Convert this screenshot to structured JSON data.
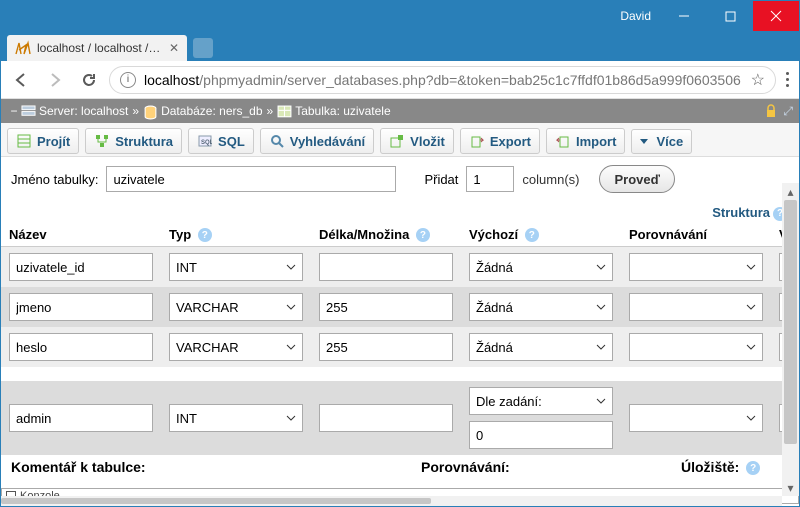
{
  "window": {
    "user": "David"
  },
  "tab": {
    "title": "localhost / localhost / ne"
  },
  "url": {
    "host": "localhost",
    "path": "/phpmyadmin/server_databases.php?db=&token=bab25c1c7ffdf01b86d5a999f0603506"
  },
  "breadcrumb": {
    "server_label": "Server:",
    "server": "localhost",
    "db_label": "Databáze:",
    "db": "ners_db",
    "table_label": "Tabulka:",
    "table": "uzivatele"
  },
  "tabs": {
    "browse": "Projít",
    "structure": "Struktura",
    "sql": "SQL",
    "search": "Vyhledávání",
    "insert": "Vložit",
    "export": "Export",
    "import": "Import",
    "more": "Více"
  },
  "form": {
    "table_name_label": "Jméno tabulky:",
    "table_name": "uzivatele",
    "add_label": "Přidat",
    "add_count": "1",
    "col_suffix": "column(s)",
    "go": "Proveď"
  },
  "grid": {
    "section": "Struktura",
    "headers": {
      "name": "Název",
      "type": "Typ",
      "length": "Délka/Množina",
      "default": "Výchozí",
      "collation": "Porovnávání",
      "attr": "Vlas"
    },
    "rows": [
      {
        "name": "uzivatele_id",
        "type": "INT",
        "length": "",
        "default_mode": "Žádná",
        "default_value": "",
        "collation": ""
      },
      {
        "name": "jmeno",
        "type": "VARCHAR",
        "length": "255",
        "default_mode": "Žádná",
        "default_value": "",
        "collation": ""
      },
      {
        "name": "heslo",
        "type": "VARCHAR",
        "length": "255",
        "default_mode": "Žádná",
        "default_value": "",
        "collation": ""
      },
      {
        "name": "admin",
        "type": "INT",
        "length": "",
        "default_mode": "Dle zadání:",
        "default_value": "0",
        "collation": ""
      }
    ]
  },
  "bottom": {
    "comment": "Komentář k tabulce:",
    "collation": "Porovnávání:",
    "storage": "Úložiště:"
  },
  "console": "Konzole"
}
